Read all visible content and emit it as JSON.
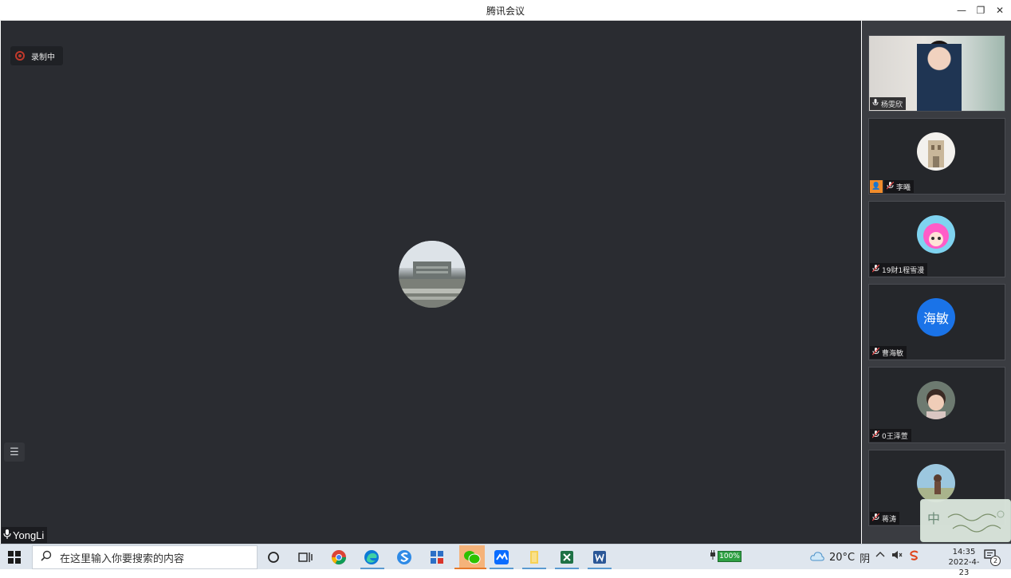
{
  "window": {
    "title": "腾讯会议",
    "minimize": "—",
    "restore": "❐",
    "close": "✕"
  },
  "meeting": {
    "recording_label": "录制中",
    "list_icon": "☰",
    "self_name": "YongLi",
    "mic_icon": "🎙"
  },
  "participants": [
    {
      "name": "杨雯欣",
      "kind": "video"
    },
    {
      "name": "李曦",
      "kind": "photo",
      "host": true
    },
    {
      "name": "19财1程雪漫",
      "kind": "photo"
    },
    {
      "name": "曹海敏",
      "kind": "text-avatar",
      "avatar_text": "海敏"
    },
    {
      "name": "0王泽萱",
      "kind": "photo"
    },
    {
      "name": "蒋涛",
      "kind": "photo"
    }
  ],
  "host_icon": "👤",
  "ime": {
    "mode": "中"
  },
  "taskbar": {
    "search_placeholder": "在这里输入你要搜索的内容",
    "battery": "100%",
    "temperature": "20°C",
    "weather": "阴",
    "time": "14:35",
    "date": "2022-4-23",
    "notifications": "2"
  },
  "colors": {
    "meeting_bg": "#2a2c31",
    "sidebar_bg": "#3a3c41",
    "record_red": "#c0392b",
    "avatar_blue": "#1a73e8",
    "host_orange": "#f08c2c"
  }
}
